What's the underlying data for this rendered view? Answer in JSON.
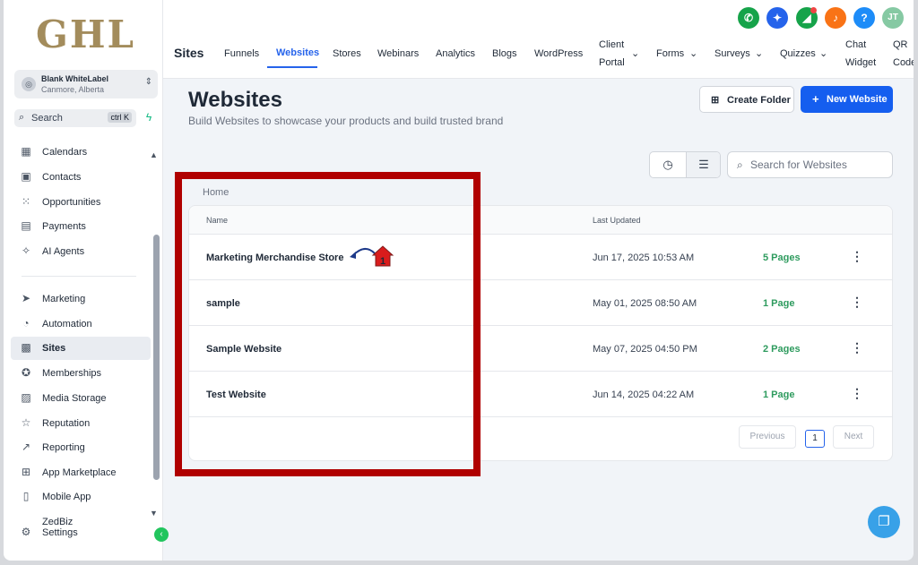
{
  "logo": "GHL",
  "account": {
    "name": "Blank WhiteLabel",
    "location": "Canmore, Alberta",
    "avatar": "◎"
  },
  "sidebar_search": {
    "label": "Search",
    "shortcut": "ctrl K"
  },
  "sidebar": {
    "items": [
      {
        "label": "Calendars",
        "icon": "calendar-icon",
        "glyph": "▦"
      },
      {
        "label": "Contacts",
        "icon": "contacts-icon",
        "glyph": "▣"
      },
      {
        "label": "Opportunities",
        "icon": "opportunities-icon",
        "glyph": "⁙"
      },
      {
        "label": "Payments",
        "icon": "payments-icon",
        "glyph": "▤"
      },
      {
        "label": "AI Agents",
        "icon": "sparkle-icon",
        "glyph": "✧"
      },
      {
        "label": "Marketing",
        "icon": "send-icon",
        "glyph": "➤"
      },
      {
        "label": "Automation",
        "icon": "automation-icon",
        "glyph": "◔"
      },
      {
        "label": "Sites",
        "icon": "sites-icon",
        "glyph": "▩"
      },
      {
        "label": "Memberships",
        "icon": "membership-icon",
        "glyph": "✪"
      },
      {
        "label": "Media Storage",
        "icon": "image-icon",
        "glyph": "▨"
      },
      {
        "label": "Reputation",
        "icon": "star-icon",
        "glyph": "☆"
      },
      {
        "label": "Reporting",
        "icon": "trend-icon",
        "glyph": "↗"
      },
      {
        "label": "App Marketplace",
        "icon": "grid-icon",
        "glyph": "⊞"
      },
      {
        "label": "Mobile App",
        "icon": "mobile-icon",
        "glyph": "▯"
      },
      {
        "label": "ZedBiz",
        "icon": "",
        "glyph": ""
      },
      {
        "label": "Settings",
        "icon": "gear-icon",
        "glyph": "⚙"
      }
    ]
  },
  "topnav": {
    "title": "Sites",
    "tabs": [
      "Funnels",
      "Websites",
      "Stores",
      "Webinars",
      "Analytics",
      "Blogs",
      "WordPress",
      "Client",
      "Portal",
      "Forms",
      "Surveys",
      "Quizzes",
      "Chat",
      "Widget",
      "QR",
      "Code"
    ],
    "icons": [
      {
        "name": "phone-icon",
        "glyph": "✆",
        "color": "#16a34a"
      },
      {
        "name": "magic-wand-icon",
        "glyph": "✦",
        "color": "#2563eb"
      },
      {
        "name": "megaphone-icon",
        "glyph": "◢",
        "color": "#16a34a"
      },
      {
        "name": "bell-icon",
        "glyph": "♪",
        "color": "#f97316"
      },
      {
        "name": "help-icon",
        "glyph": "?",
        "color": "#1d8cf8"
      },
      {
        "name": "avatar",
        "glyph": "JT",
        "color": "#86c9a3"
      }
    ]
  },
  "page": {
    "title": "Websites",
    "subtitle": "Build Websites to showcase your products and build trusted brand",
    "create_folder": "Create Folder",
    "new_website": "New Website",
    "search_placeholder": "Search for Websites",
    "breadcrumb": "Home"
  },
  "table": {
    "headers": [
      "Name",
      "Last Updated"
    ],
    "rows": [
      {
        "name": "Marketing Merchandise Store",
        "updated": "Jun 17, 2025 10:53 AM",
        "pages": "5 Pages"
      },
      {
        "name": "sample",
        "updated": "May 01, 2025 08:50 AM",
        "pages": "1 Page"
      },
      {
        "name": "Sample Website",
        "updated": "May 07, 2025 04:50 PM",
        "pages": "2 Pages"
      },
      {
        "name": "Test Website",
        "updated": "Jun 14, 2025 04:22 AM",
        "pages": "1 Page"
      }
    ]
  },
  "pagination": {
    "previous": "Previous",
    "current": "1",
    "next": "Next"
  },
  "annotation": {
    "step": "1",
    "highlight_color": "#b00000"
  }
}
